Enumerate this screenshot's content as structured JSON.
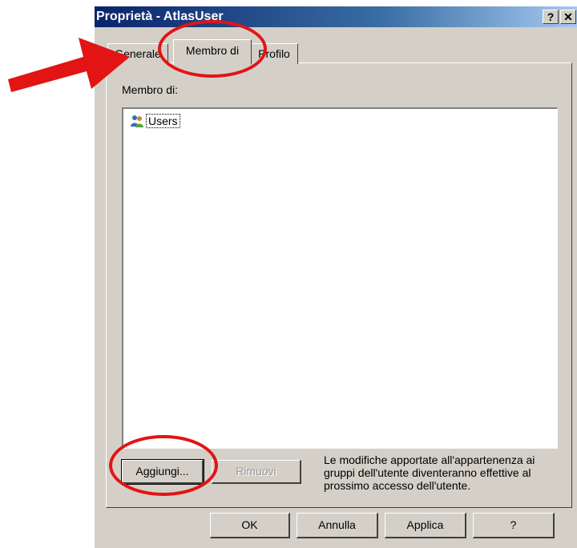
{
  "window": {
    "title": "Proprietà - AtlasUser",
    "help_button": "?",
    "close_button": "✕"
  },
  "tabs": [
    {
      "label": "Generale",
      "selected": false
    },
    {
      "label": "Membro di",
      "selected": true
    },
    {
      "label": "Profilo",
      "selected": false
    }
  ],
  "membership": {
    "label": "Membro di:",
    "items": [
      {
        "name": "Users",
        "icon": "users-group-icon"
      }
    ]
  },
  "actions": {
    "add_label": "Aggiungi...",
    "remove_label": "Rimuovi"
  },
  "info_note": "Le modifiche apportate all'appartenenza ai gruppi dell'utente diventeranno effettive al prossimo accesso dell'utente.",
  "footer": {
    "ok_label": "OK",
    "cancel_label": "Annulla",
    "apply_label": "Applica",
    "help_label": "?"
  },
  "colors": {
    "annotation": "#e21414",
    "title_bar": "#0a246a",
    "dialog": "#d4d0c8"
  }
}
